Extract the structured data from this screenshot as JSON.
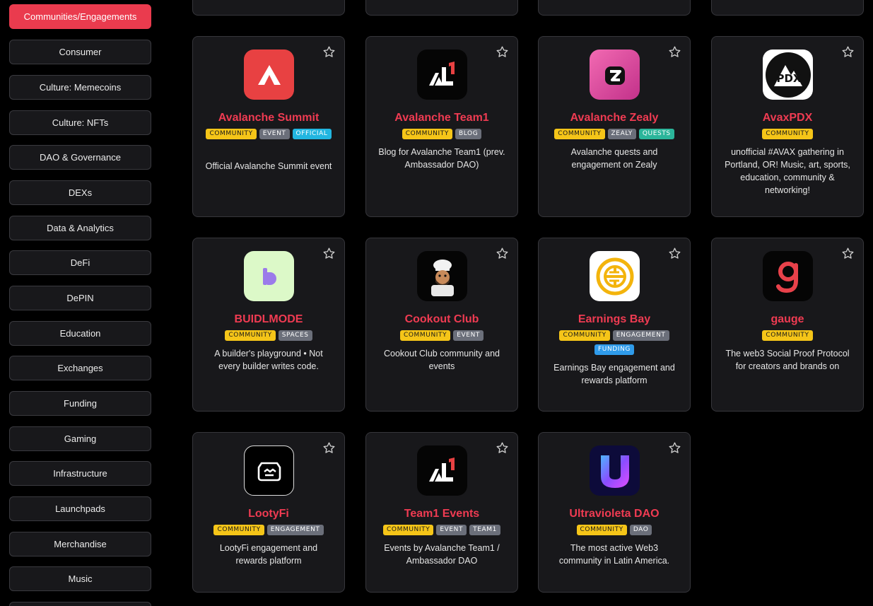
{
  "sidebar": {
    "items": [
      {
        "label": "Communities/Engagements",
        "active": true
      },
      {
        "label": "Consumer"
      },
      {
        "label": "Culture: Memecoins"
      },
      {
        "label": "Culture: NFTs"
      },
      {
        "label": "DAO & Governance"
      },
      {
        "label": "DEXs"
      },
      {
        "label": "Data & Analytics"
      },
      {
        "label": "DeFi"
      },
      {
        "label": "DePIN"
      },
      {
        "label": "Education"
      },
      {
        "label": "Exchanges"
      },
      {
        "label": "Funding"
      },
      {
        "label": "Gaming"
      },
      {
        "label": "Infrastructure"
      },
      {
        "label": "Launchpads"
      },
      {
        "label": "Merchandise"
      },
      {
        "label": "Music"
      }
    ]
  },
  "colors": {
    "accent": "#ea3b4e",
    "title": "#ef3b52",
    "community_tag": "#f5c518"
  },
  "cards": [
    {
      "title": "Avalanche Summit",
      "tags": [
        "COMMUNITY",
        "EVENT",
        "OFFICIAL"
      ],
      "description": "Official Avalanche Summit event",
      "logo": "avalanche-logo"
    },
    {
      "title": "Avalanche Team1",
      "tags": [
        "COMMUNITY",
        "BLOG"
      ],
      "description": "Blog for Avalanche Team1 (prev. Ambassador DAO)",
      "logo": "team1-logo"
    },
    {
      "title": "Avalanche Zealy",
      "tags": [
        "COMMUNITY",
        "ZEALY",
        "QUESTS"
      ],
      "description": "Avalanche quests and engagement on Zealy",
      "logo": "zealy-logo"
    },
    {
      "title": "AvaxPDX",
      "tags": [
        "COMMUNITY"
      ],
      "description": "unofficial #AVAX gathering in Portland, OR! Music, art, sports, education, community & networking!",
      "logo": "avaxpdx-logo"
    },
    {
      "title": "BUIDLMODE",
      "tags": [
        "COMMUNITY",
        "SPACES"
      ],
      "description": "A builder's playground • Not every builder writes code.",
      "logo": "buidlmode-logo"
    },
    {
      "title": "Cookout Club",
      "tags": [
        "COMMUNITY",
        "EVENT"
      ],
      "description": "Cookout Club community and events",
      "logo": "chef-logo"
    },
    {
      "title": "Earnings Bay",
      "tags": [
        "COMMUNITY",
        "ENGAGEMENT",
        "FUNDING"
      ],
      "description": "Earnings Bay engagement and rewards platform",
      "logo": "earnings-bay-logo"
    },
    {
      "title": "gauge",
      "tags": [
        "COMMUNITY"
      ],
      "description": "The web3 Social Proof Protocol for creators and brands on",
      "logo": "gauge-logo"
    },
    {
      "title": "LootyFi",
      "tags": [
        "COMMUNITY",
        "ENGAGEMENT"
      ],
      "description": "LootyFi engagement and rewards platform",
      "logo": "lootyfi-logo"
    },
    {
      "title": "Team1 Events",
      "tags": [
        "COMMUNITY",
        "EVENT",
        "TEAM1"
      ],
      "description": "Events by Avalanche Team1 / Ambassador DAO",
      "logo": "team1-logo"
    },
    {
      "title": "Ultravioleta DAO",
      "tags": [
        "COMMUNITY",
        "DAO"
      ],
      "description": "The most active Web3 community in Latin America.",
      "logo": "ultravioleta-logo"
    }
  ]
}
